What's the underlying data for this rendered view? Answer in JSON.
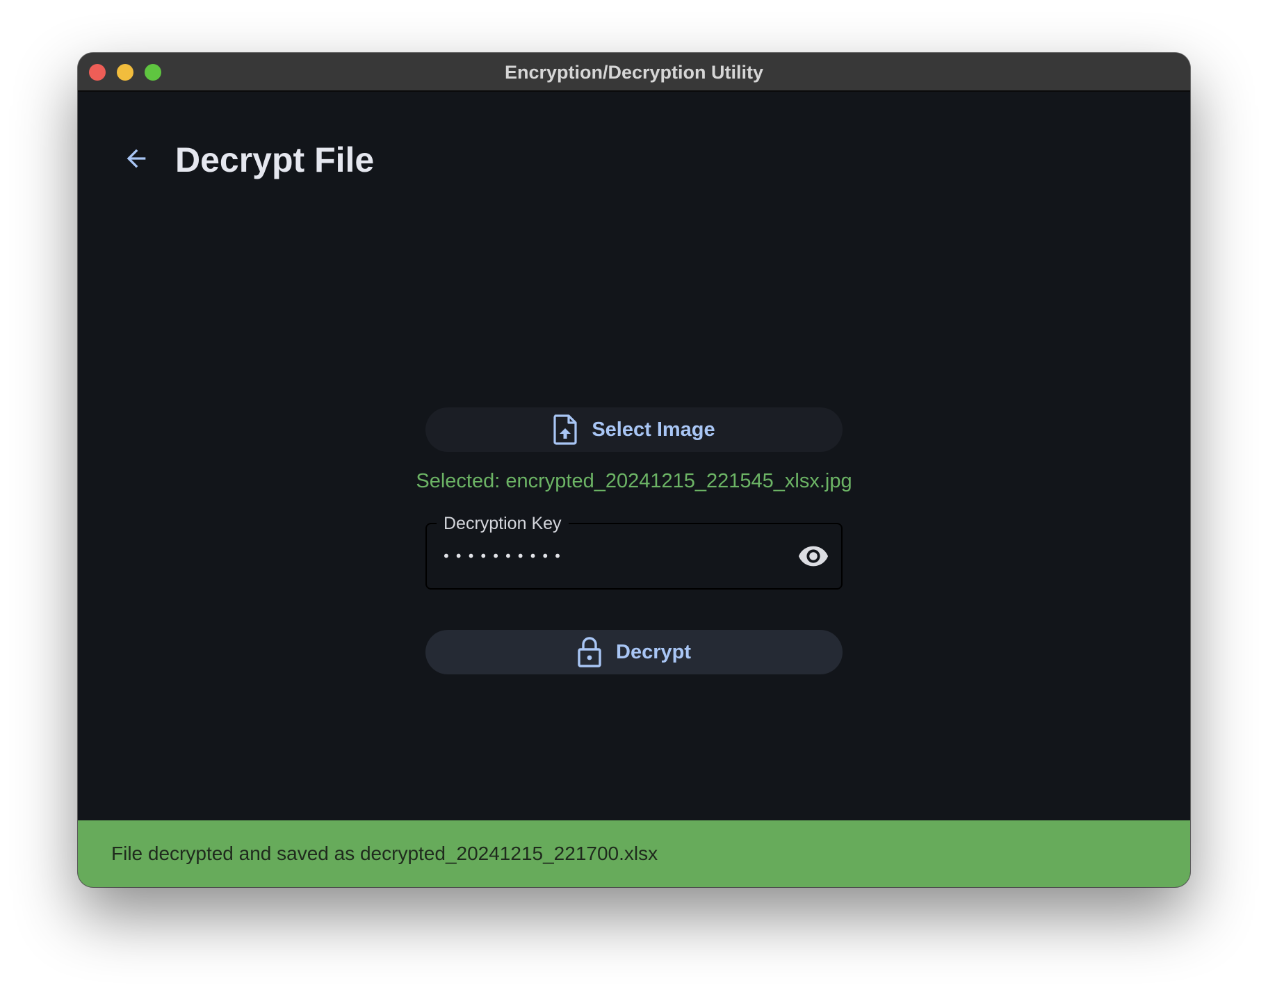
{
  "window": {
    "title": "Encryption/Decryption Utility"
  },
  "header": {
    "back_icon": "arrow-left-icon",
    "title": "Decrypt File"
  },
  "select_button": {
    "icon": "file-upload-icon",
    "label": "Select Image"
  },
  "selected_file": {
    "text": "Selected: encrypted_20241215_221545_xlsx.jpg"
  },
  "key_field": {
    "label": "Decryption Key",
    "value": "••••••••••",
    "toggle_icon": "eye-icon"
  },
  "decrypt_button": {
    "icon": "lock-open-icon",
    "label": "Decrypt"
  },
  "snackbar": {
    "message": "File decrypted and saved as decrypted_20241215_221700.xlsx"
  },
  "colors": {
    "background": "#12151a",
    "accent": "#a9c6f5",
    "success_text": "#6cb465",
    "snackbar": "#67ab5b"
  }
}
